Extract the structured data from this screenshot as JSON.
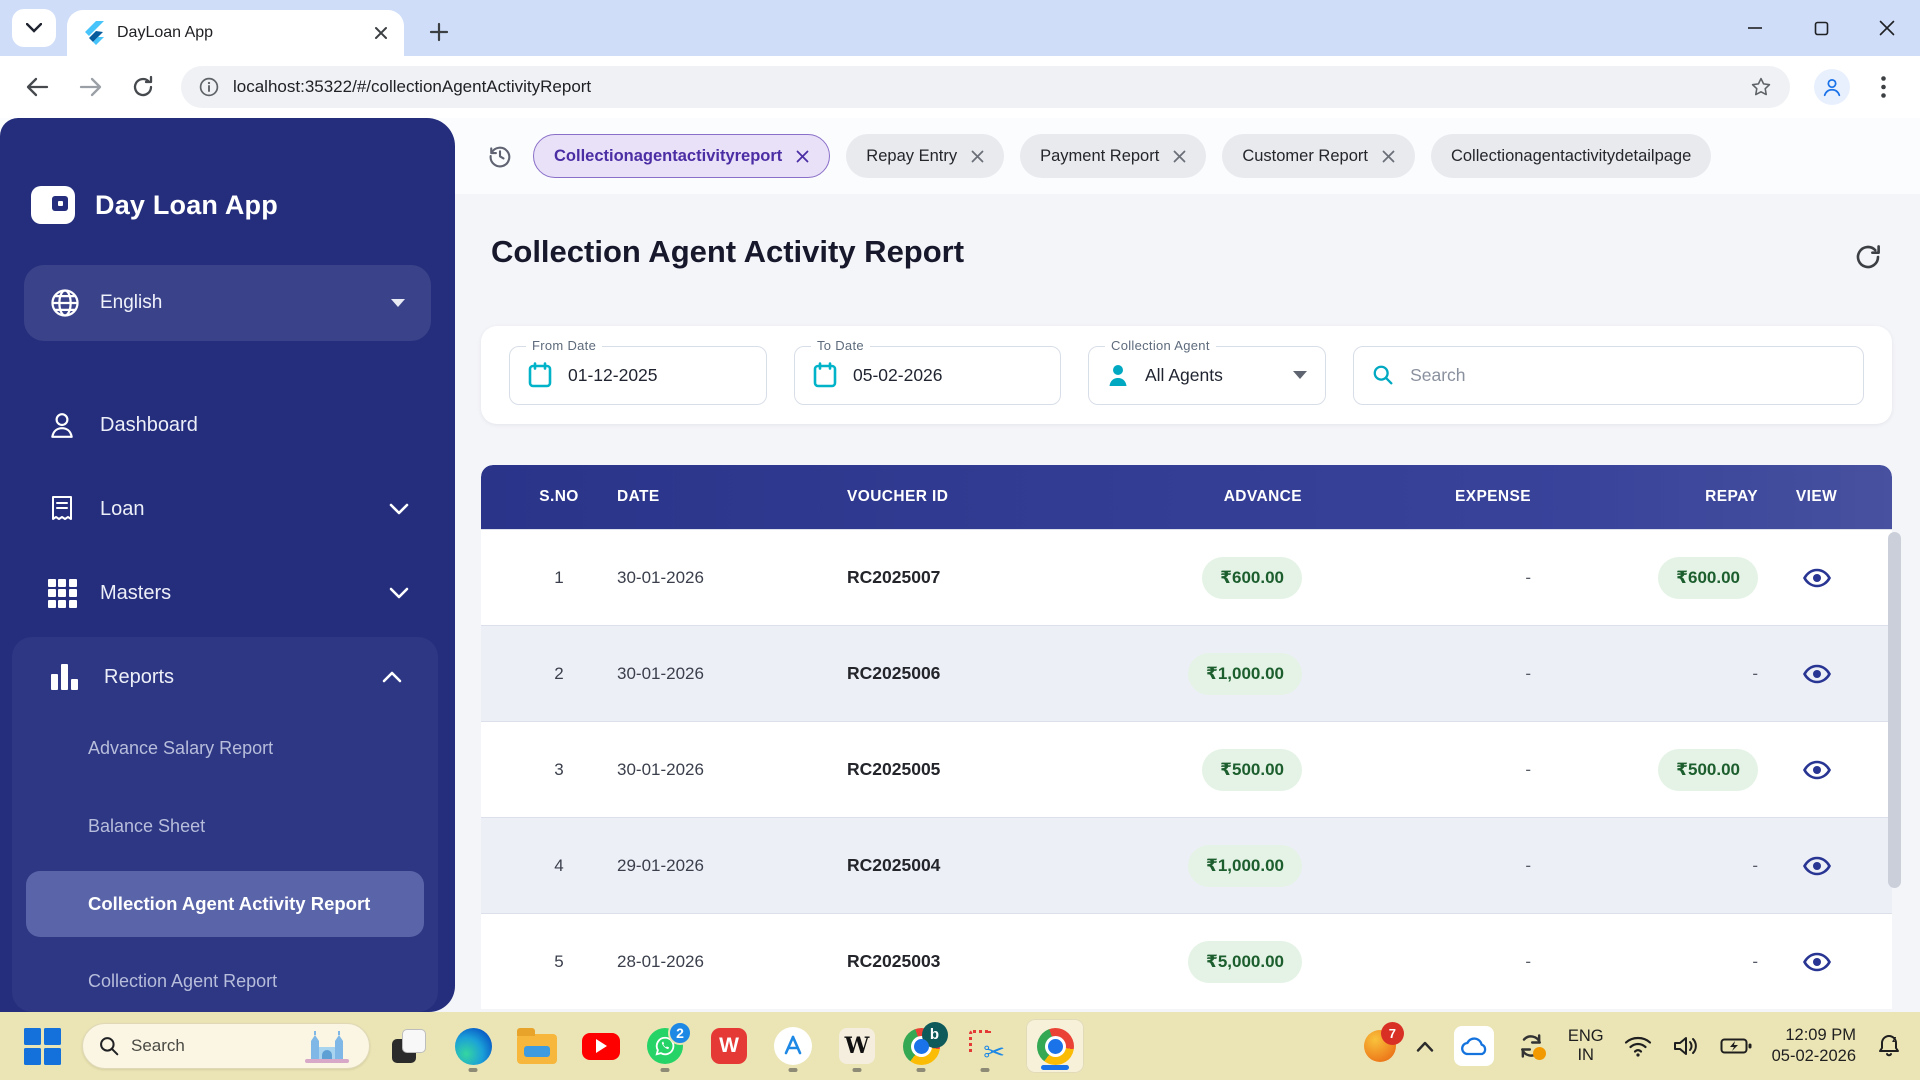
{
  "browser": {
    "tab_title": "DayLoan App",
    "url": "localhost:35322/#/collectionAgentActivityReport"
  },
  "chips": {
    "items": [
      {
        "label": "Collectionagentactivityreport",
        "active": true
      },
      {
        "label": "Repay Entry",
        "active": false
      },
      {
        "label": "Payment Report",
        "active": false
      },
      {
        "label": "Customer Report",
        "active": false
      },
      {
        "label": "Collectionagentactivitydetailpage",
        "active": false
      }
    ]
  },
  "sidebar": {
    "brand": "Day Loan App",
    "language": "English",
    "nav": [
      {
        "label": "Dashboard"
      },
      {
        "label": "Loan"
      },
      {
        "label": "Masters"
      },
      {
        "label": "Reports"
      }
    ],
    "reports_sub": [
      {
        "label": "Advance Salary Report"
      },
      {
        "label": "Balance Sheet"
      },
      {
        "label": "Collection Agent Activity Report"
      },
      {
        "label": "Collection Agent Report"
      }
    ],
    "active_item": "Collection Agent Activity Report"
  },
  "page": {
    "title": "Collection Agent Activity Report",
    "filters": {
      "from_label": "From Date",
      "from_value": "01-12-2025",
      "to_label": "To Date",
      "to_value": "05-02-2026",
      "agent_label": "Collection Agent",
      "agent_value": "All Agents",
      "search_placeholder": "Search"
    },
    "table": {
      "columns": {
        "sno": "S.NO",
        "date": "DATE",
        "voucher": "VOUCHER ID",
        "advance": "ADVANCE",
        "expense": "EXPENSE",
        "repay": "REPAY",
        "view": "VIEW"
      },
      "rows": [
        {
          "sno": "1",
          "date": "30-01-2026",
          "voucher": "RC2025007",
          "advance": "₹600.00",
          "expense": "-",
          "repay": "₹600.00"
        },
        {
          "sno": "2",
          "date": "30-01-2026",
          "voucher": "RC2025006",
          "advance": "₹1,000.00",
          "expense": "-",
          "repay": "-"
        },
        {
          "sno": "3",
          "date": "30-01-2026",
          "voucher": "RC2025005",
          "advance": "₹500.00",
          "expense": "-",
          "repay": "₹500.00"
        },
        {
          "sno": "4",
          "date": "29-01-2026",
          "voucher": "RC2025004",
          "advance": "₹1,000.00",
          "expense": "-",
          "repay": "-"
        },
        {
          "sno": "5",
          "date": "28-01-2026",
          "voucher": "RC2025003",
          "advance": "₹5,000.00",
          "expense": "-",
          "repay": "-"
        }
      ]
    }
  },
  "taskbar": {
    "search_placeholder": "Search",
    "whatsapp_badge": "2",
    "notification_badge": "7",
    "lang_top": "ENG",
    "lang_bottom": "IN",
    "time": "12:09 PM",
    "date": "05-02-2026"
  },
  "colors": {
    "sidebar_bg": "#242E7C",
    "table_header_bg": "#2F3B94",
    "accent_teal": "#00A9C1",
    "chip_active_text": "#4B2DA4",
    "pill_green_bg": "#E4F3E5",
    "pill_green_text": "#1C5E2E",
    "taskbar_bg": "#EBE5B6"
  }
}
